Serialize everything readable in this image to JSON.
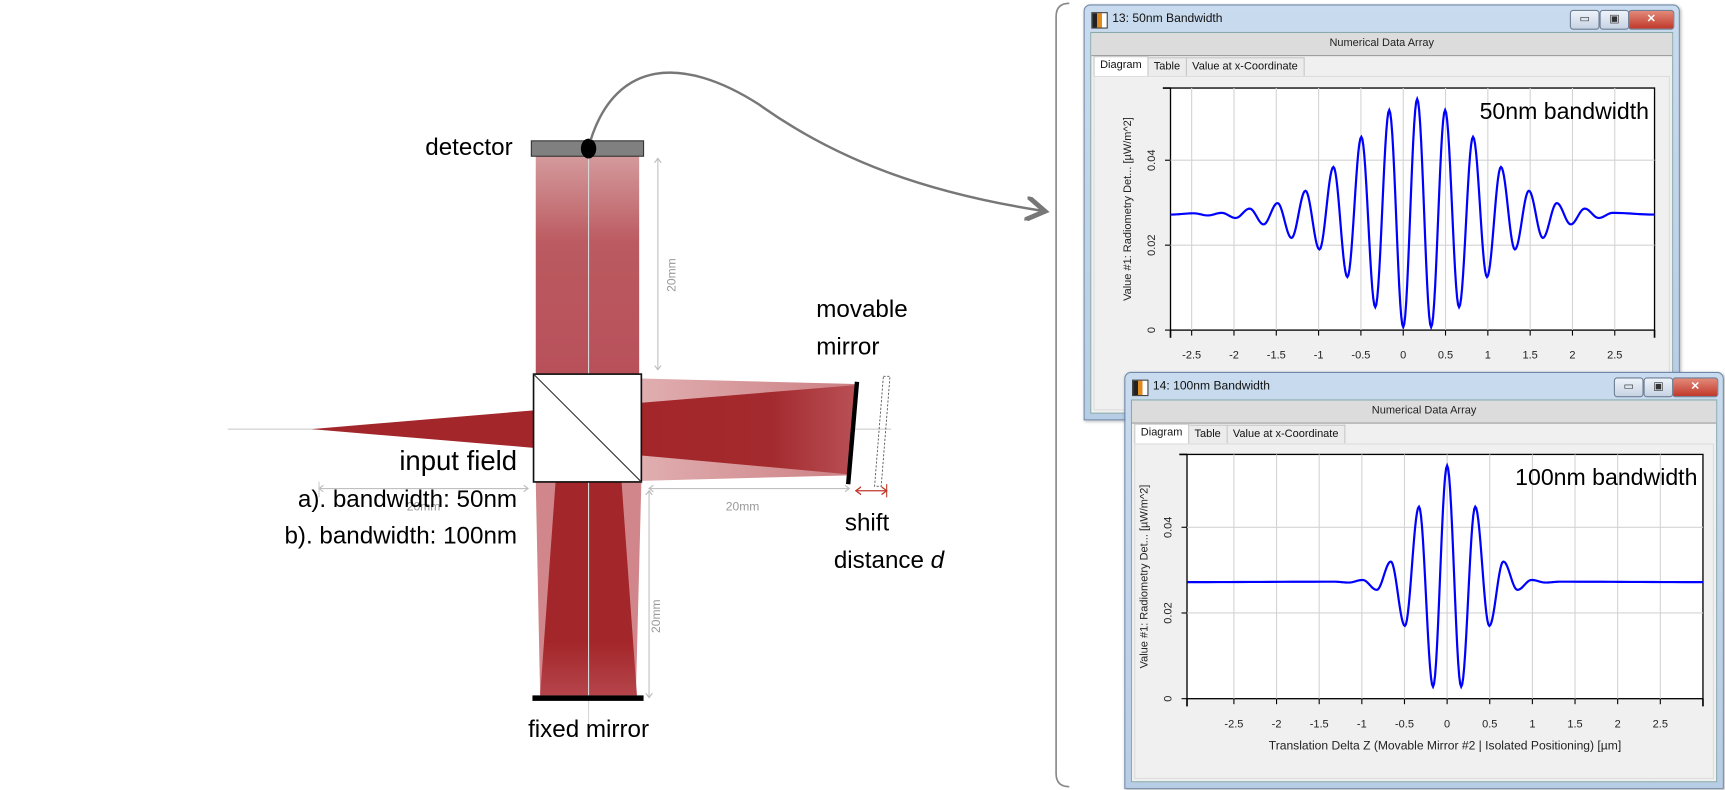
{
  "diagram": {
    "labels": {
      "detector": "detector",
      "movable_mirror_1": "movable",
      "movable_mirror_2": "mirror",
      "input_field": "input field",
      "bandwidth_a": "a). bandwidth: 50nm",
      "bandwidth_b": "b). bandwidth: 100nm",
      "shift_1": "shift",
      "shift_2": "distance ",
      "shift_var": "d",
      "fixed_mirror": "fixed mirror"
    },
    "dimensions": {
      "detector_arm": "20mm",
      "input_arm": "20mm",
      "movable_arm": "20mm",
      "fixed_arm": "20mm"
    },
    "colors": {
      "beam_dark": "#a3262a",
      "beam_light": "#d0868a",
      "shift_arrow": "#c0392b"
    }
  },
  "windows": [
    {
      "title": "13: 50nm Bandwidth",
      "header": "Numerical Data Array",
      "tabs": [
        "Diagram",
        "Table",
        "Value at x-Coordinate"
      ],
      "active_tab": "Diagram",
      "buttons": {
        "minimize": "▭",
        "restore": "▣",
        "close": "✕"
      }
    },
    {
      "title": "14: 100nm Bandwidth",
      "header": "Numerical Data Array",
      "tabs": [
        "Diagram",
        "Table",
        "Value at x-Coordinate"
      ],
      "active_tab": "Diagram",
      "buttons": {
        "minimize": "▭",
        "restore": "▣",
        "close": "✕"
      }
    }
  ],
  "chart_data": [
    {
      "type": "line",
      "annotation": "50nm bandwidth",
      "ylabel": "Value #1: Radiometry Det... [µW/m^2]",
      "xlabel": "",
      "xlim": [
        -2.75,
        2.97
      ],
      "ylim": [
        0,
        0.057
      ],
      "x_ticks": [
        -2.5,
        -2,
        -1.5,
        -1,
        -0.5,
        0,
        0.5,
        1,
        1.5,
        2,
        2.5
      ],
      "x_tick_labels": [
        "-2.5",
        "-2",
        "-1.5",
        "-1",
        "-0.5",
        "0",
        "0.5",
        "1",
        "1.5",
        "2",
        "2.5"
      ],
      "y_ticks": [
        0,
        0.02,
        0.04
      ],
      "y_tick_labels": [
        "0",
        "0.02",
        "0.04"
      ],
      "grid": true,
      "color": "#0000ff",
      "series": [
        {
          "x": [
            -2.75,
            -2.475,
            -2.31,
            -2.145,
            -1.98,
            -1.815,
            -1.65,
            -1.485,
            -1.32,
            -1.155,
            -0.99,
            -0.825,
            -0.66,
            -0.495,
            -0.33,
            -0.165,
            0,
            0.165,
            0.33,
            0.495,
            0.66,
            0.825,
            0.99,
            1.155,
            1.32,
            1.485,
            1.65,
            1.815,
            1.98,
            2.145,
            2.31,
            2.475,
            2.97
          ],
          "y": [
            0.0272,
            0.0275,
            0.027,
            0.0276,
            0.0264,
            0.0286,
            0.0249,
            0.0299,
            0.0217,
            0.0328,
            0.019,
            0.0384,
            0.0125,
            0.0455,
            0.0054,
            0.0518,
            0.0007,
            0.0544,
            0.0007,
            0.0518,
            0.0054,
            0.0455,
            0.0125,
            0.0384,
            0.019,
            0.0328,
            0.0217,
            0.0299,
            0.0249,
            0.0286,
            0.0264,
            0.0276,
            0.0272
          ]
        }
      ]
    },
    {
      "type": "line",
      "annotation": "100nm bandwidth",
      "ylabel": "Value #1: Radiometry Det... [µW/m^2]",
      "xlabel": "Translation Delta Z (Movable Mirror #2 | Isolated Positioning) [µm]",
      "xlim": [
        -3.05,
        3.0
      ],
      "ylim": [
        0,
        0.057
      ],
      "x_ticks": [
        -2.5,
        -2,
        -1.5,
        -1,
        -0.5,
        0,
        0.5,
        1,
        1.5,
        2,
        2.5
      ],
      "x_tick_labels": [
        "-2.5",
        "-2",
        "-1.5",
        "-1",
        "-0.5",
        "0",
        "0.5",
        "1",
        "1.5",
        "2",
        "2.5"
      ],
      "y_ticks": [
        0,
        0.02,
        0.04
      ],
      "y_tick_labels": [
        "0",
        "0.02",
        "0.04"
      ],
      "grid": true,
      "color": "#0000ff",
      "series": [
        {
          "x": [
            -3.05,
            -1.32,
            -1.155,
            -0.99,
            -0.825,
            -0.66,
            -0.495,
            -0.33,
            -0.165,
            0,
            0.165,
            0.33,
            0.495,
            0.66,
            0.825,
            0.99,
            1.155,
            1.32,
            3.0
          ],
          "y": [
            0.0272,
            0.0273,
            0.0271,
            0.0277,
            0.0254,
            0.032,
            0.017,
            0.0448,
            0.0028,
            0.0544,
            0.0028,
            0.0448,
            0.017,
            0.032,
            0.0254,
            0.0277,
            0.0271,
            0.0273,
            0.0272
          ]
        }
      ]
    }
  ]
}
